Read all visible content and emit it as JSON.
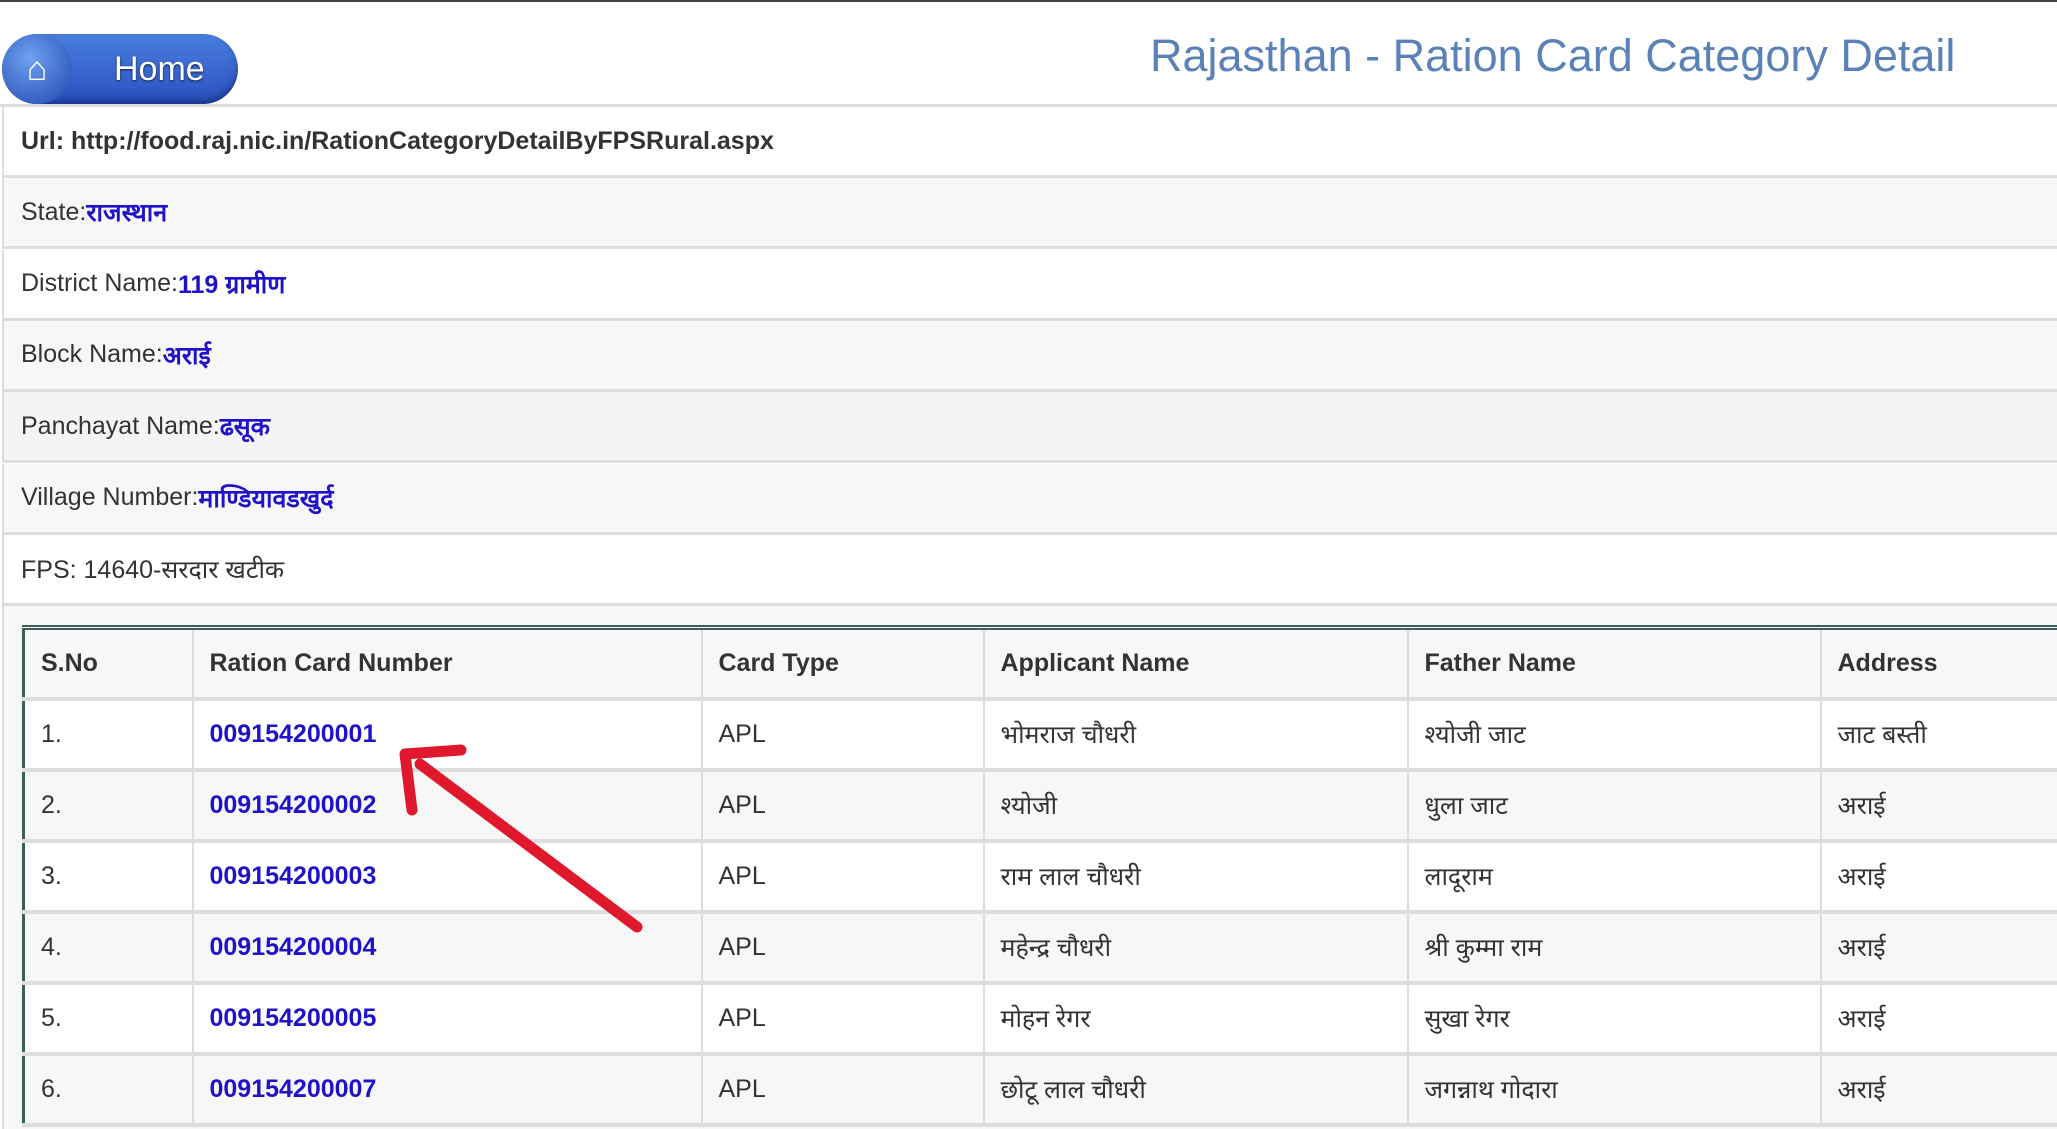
{
  "header": {
    "home_label": "Home",
    "title": "Rajasthan - Ration Card Category Detail"
  },
  "info": [
    {
      "label": "Url: http://food.raj.nic.in/RationCategoryDetailByFPSRural.aspx",
      "value": ""
    },
    {
      "label": "State: ",
      "value": "राजस्थान"
    },
    {
      "label": "District Name: ",
      "value": "119 ग्रामीण"
    },
    {
      "label": "Block Name: ",
      "value": "अराई"
    },
    {
      "label": "Panchayat Name: ",
      "value": "ढसूक"
    },
    {
      "label": "Village Number: ",
      "value": "माण्डियावडखुर्द"
    },
    {
      "label": "FPS: 14640-सरदार खटीक",
      "value": ""
    }
  ],
  "table": {
    "headers": [
      "S.No",
      "Ration Card Number",
      "Card Type",
      "Applicant Name",
      "Father Name",
      "Address"
    ],
    "rows": [
      [
        "1.",
        "009154200001",
        "APL",
        "भोमराज चौधरी",
        "श्योजी जाट",
        "जाट बस्ती"
      ],
      [
        "2.",
        "009154200002",
        "APL",
        "श्योजी",
        "धुला जाट",
        "अराई"
      ],
      [
        "3.",
        "009154200003",
        "APL",
        "राम लाल चौधरी",
        "लादूराम",
        "अराई"
      ],
      [
        "4.",
        "009154200004",
        "APL",
        "महेन्द्र चौधरी",
        "श्री कुम्मा राम",
        "अराई"
      ],
      [
        "5.",
        "009154200005",
        "APL",
        "मोहन रेगर",
        "सुखा रेगर",
        "अराई"
      ],
      [
        "6.",
        "009154200007",
        "APL",
        "छोटू लाल चौधरी",
        "जगन्नाथ गोदारा",
        "अराई"
      ]
    ]
  },
  "colors": {
    "link": "#2012c8",
    "title": "#5b82b8",
    "arrow": "#e0182e"
  }
}
